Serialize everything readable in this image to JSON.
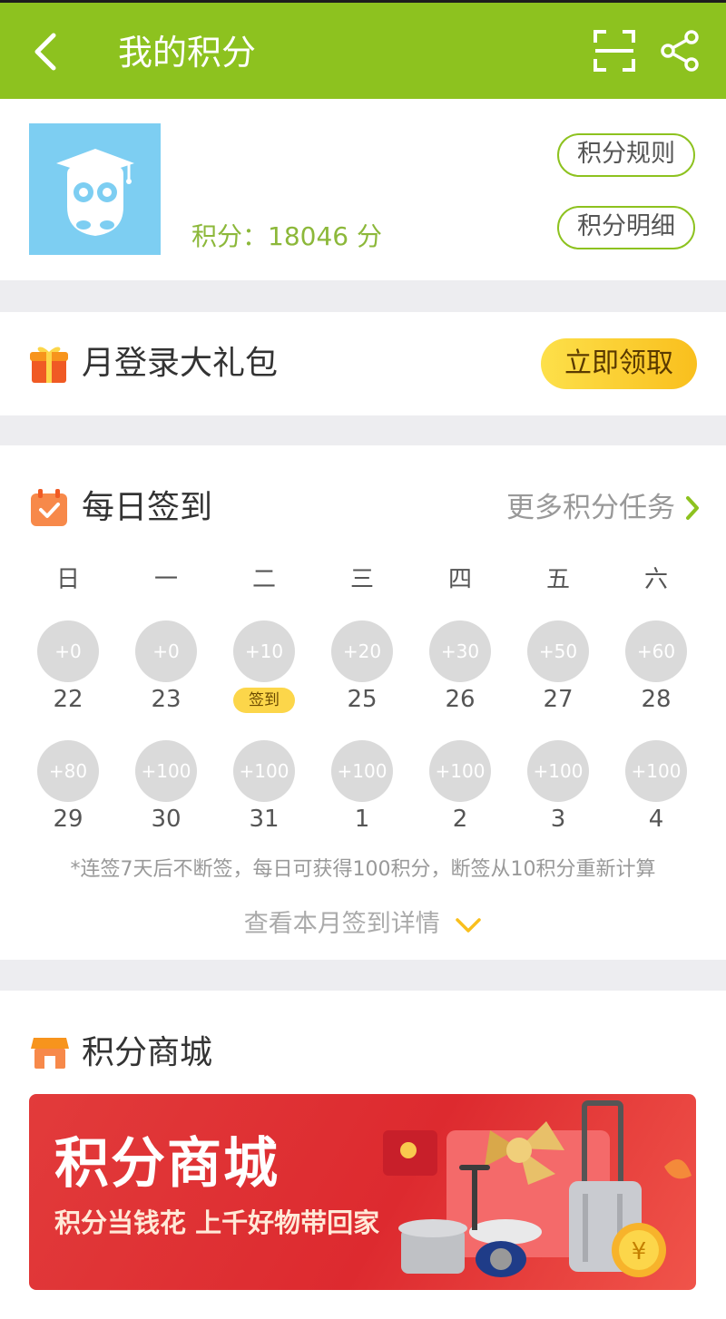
{
  "header": {
    "title": "我的积分"
  },
  "profile": {
    "points_text": "积分：18046 分",
    "rules_label": "积分规则",
    "details_label": "积分明细"
  },
  "gift": {
    "title": "月登录大礼包",
    "claim_label": "立即领取"
  },
  "checkin": {
    "title": "每日签到",
    "more_label": "更多积分任务",
    "weekdays": [
      "日",
      "一",
      "二",
      "三",
      "四",
      "五",
      "六"
    ],
    "week1": [
      {
        "bonus": "+0",
        "day": "22"
      },
      {
        "bonus": "+0",
        "day": "23"
      },
      {
        "bonus": "+10",
        "day": "签到",
        "signed": true
      },
      {
        "bonus": "+20",
        "day": "25"
      },
      {
        "bonus": "+30",
        "day": "26"
      },
      {
        "bonus": "+50",
        "day": "27"
      },
      {
        "bonus": "+60",
        "day": "28"
      }
    ],
    "week2": [
      {
        "bonus": "+80",
        "day": "29"
      },
      {
        "bonus": "+100",
        "day": "30"
      },
      {
        "bonus": "+100",
        "day": "31"
      },
      {
        "bonus": "+100",
        "day": "1"
      },
      {
        "bonus": "+100",
        "day": "2"
      },
      {
        "bonus": "+100",
        "day": "3"
      },
      {
        "bonus": "+100",
        "day": "4"
      }
    ],
    "note": "*连签7天后不断签，每日可获得100积分，断签从10积分重新计算",
    "detail_label": "查看本月签到详情"
  },
  "mall": {
    "title": "积分商城",
    "banner_title": "积分商城",
    "banner_sub": "积分当钱花 上千好物带回家"
  },
  "colors": {
    "brand_green": "#8dc21f",
    "points_green": "#8cb83a",
    "claim_yellow": "#f9bf1d",
    "banner_red": "#dd2a2f"
  },
  "icons": [
    "back-arrow-icon",
    "scan-icon",
    "share-icon",
    "gift-box-icon",
    "calendar-check-icon",
    "chevron-right-icon",
    "chevron-down-icon",
    "shop-icon",
    "owl-avatar"
  ]
}
